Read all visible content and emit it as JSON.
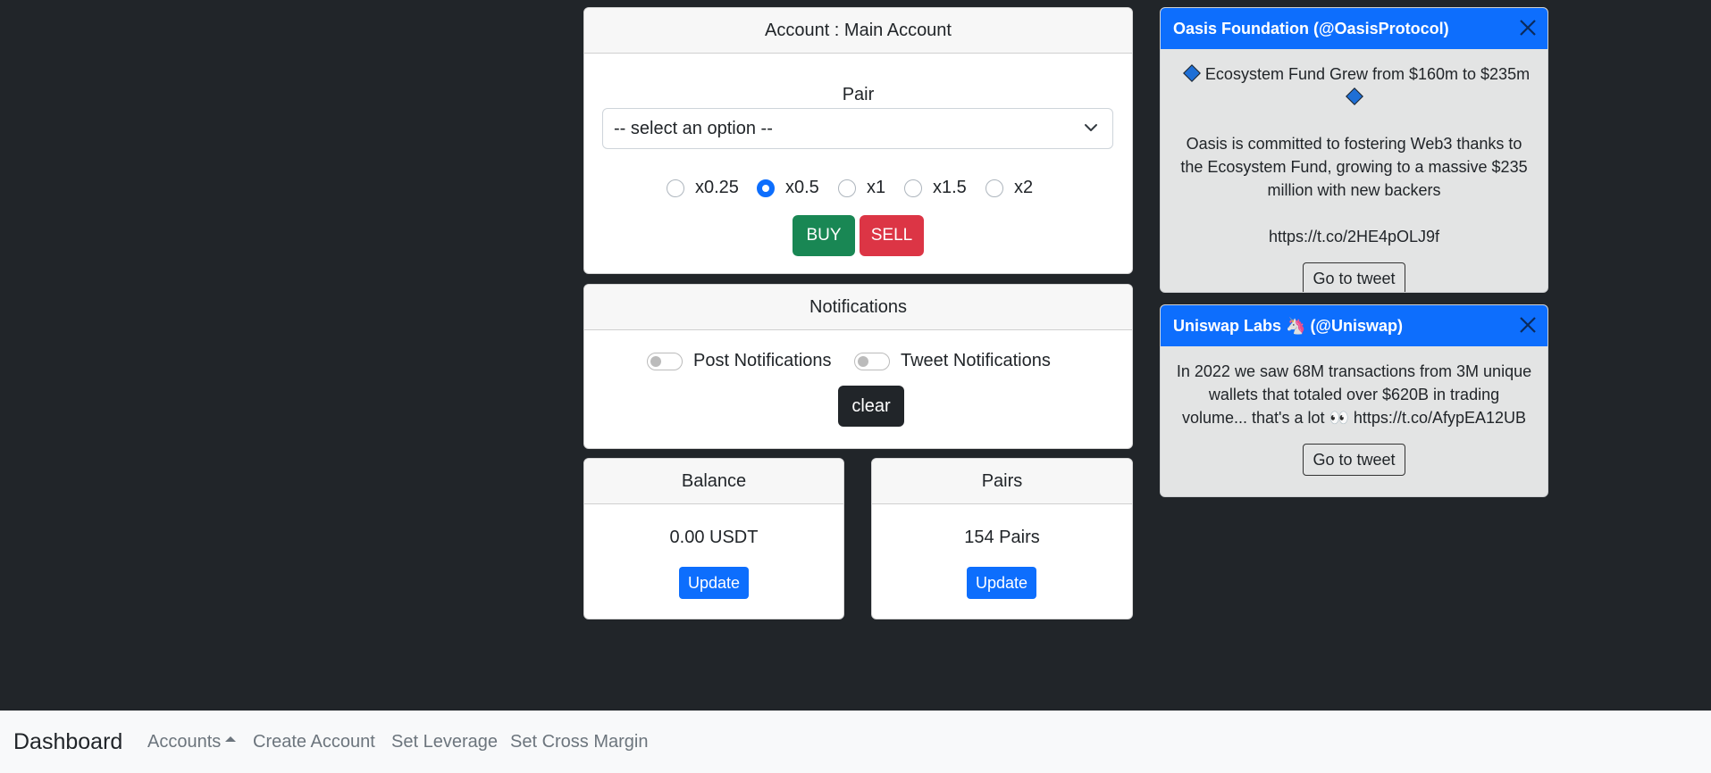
{
  "account": {
    "title": "Account : Main Account",
    "pair_label": "Pair",
    "select_value": "-- select an option --",
    "leverage_options": [
      "x0.25",
      "x0.5",
      "x1",
      "x1.5",
      "x2"
    ],
    "selected_leverage": "x0.5",
    "buy_label": "BUY",
    "sell_label": "SELL"
  },
  "notifications": {
    "title": "Notifications",
    "post_label": "Post Notifications",
    "tweet_label": "Tweet Notifications",
    "clear_label": "clear"
  },
  "balance": {
    "title": "Balance",
    "value": "0.00 USDT",
    "update_label": "Update"
  },
  "pairs": {
    "title": "Pairs",
    "value": "154 Pairs",
    "update_label": "Update"
  },
  "toasts": [
    {
      "header": "Oasis Foundation (@OasisProtocol)",
      "headline": "Ecosystem Fund Grew from $160m to $235m",
      "body": "Oasis is committed to fostering Web3 thanks to the Ecosystem Fund, growing to a massive $235 million with new backers",
      "link": "https://t.co/2HE4pOLJ9f",
      "button": "Go to tweet"
    },
    {
      "header": "Uniswap Labs 🦄 (@Uniswap)",
      "body": "In 2022 we saw 68M transactions from 3M unique wallets that totaled over $620B in trading volume... that's a lot 👀 https://t.co/AfypEA12UB",
      "button": "Go to tweet"
    }
  ],
  "navbar": {
    "brand": "Dashboard",
    "links": [
      "Accounts",
      "Create Account",
      "Set Leverage",
      "Set Cross Margin"
    ]
  },
  "colors": {
    "background": "#212529",
    "buy": "#198754",
    "sell": "#dc3545",
    "primary": "#0d6efd",
    "navbar": "#f8f9fa"
  }
}
